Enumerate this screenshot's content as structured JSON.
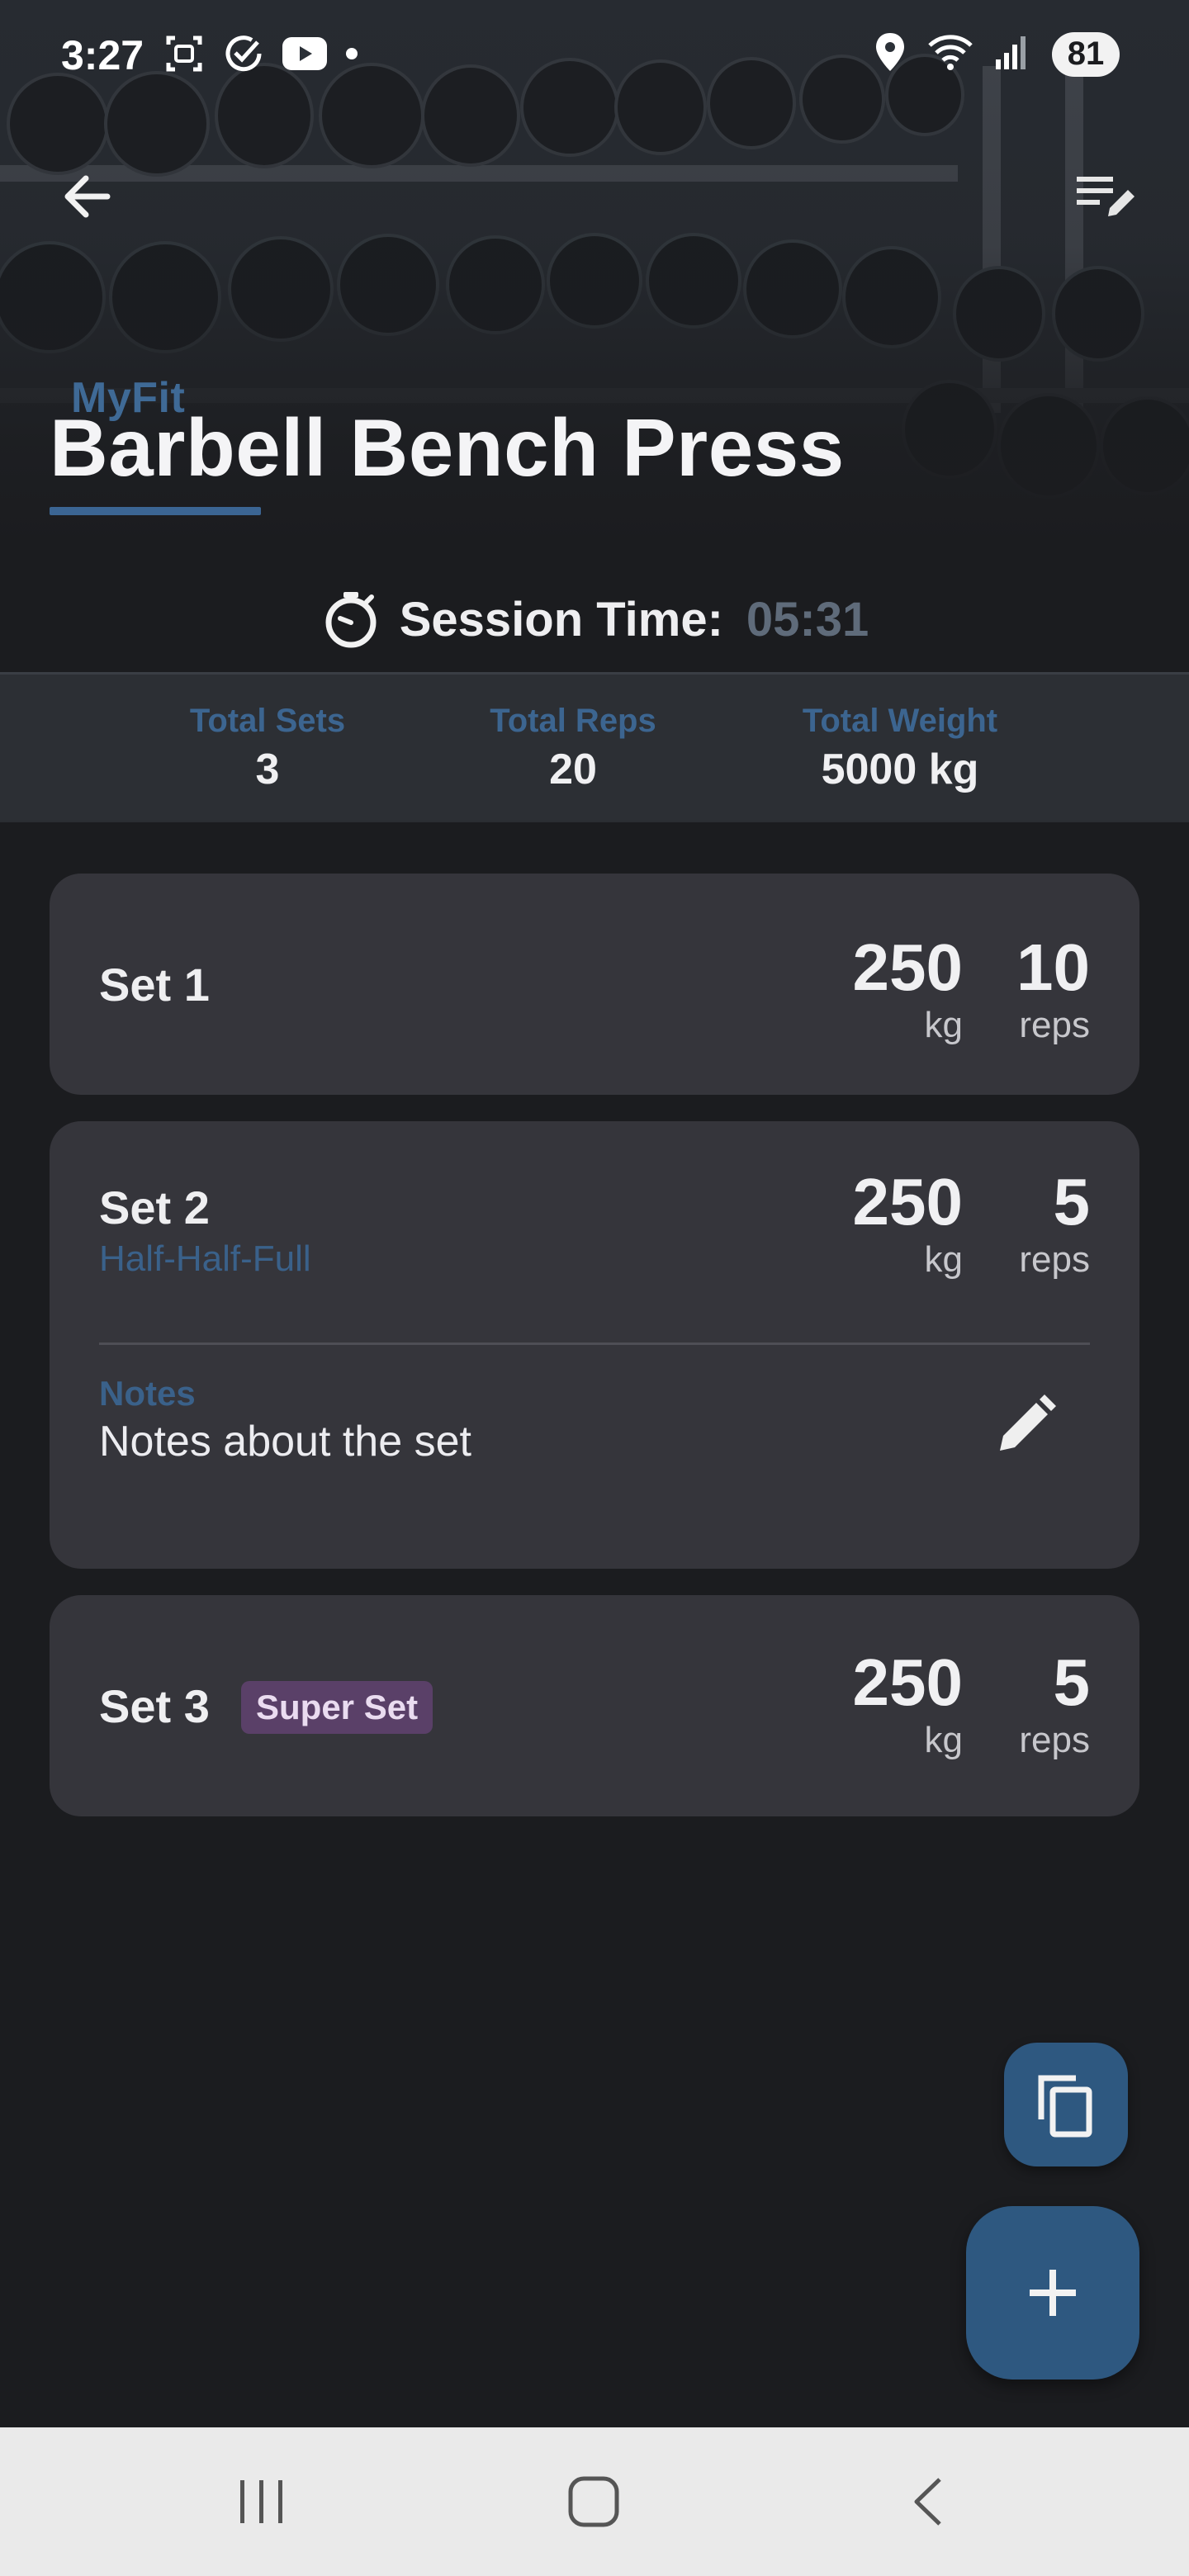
{
  "status_bar": {
    "time": "3:27",
    "battery": "81",
    "left_icons": [
      "screenshot-icon",
      "check-circle-icon",
      "youtube-icon",
      "dot-icon"
    ],
    "right_icons": [
      "location-icon",
      "wifi-icon",
      "signal-icon"
    ]
  },
  "header": {
    "brand": "MyFit",
    "title": "Barbell Bench Press",
    "back_icon": "arrow-left-icon",
    "edit_icon": "edit-list-icon"
  },
  "session": {
    "label": "Session Time:",
    "value": "05:31",
    "icon": "stopwatch-icon"
  },
  "stats": [
    {
      "label": "Total Sets",
      "value": "3"
    },
    {
      "label": "Total Reps",
      "value": "20"
    },
    {
      "label": "Total Weight",
      "value": "5000 kg"
    }
  ],
  "sets": [
    {
      "title": "Set 1",
      "weight": "250",
      "weight_unit": "kg",
      "reps": "10",
      "reps_unit": "reps"
    },
    {
      "title": "Set 2",
      "subtitle": "Half-Half-Full",
      "weight": "250",
      "weight_unit": "kg",
      "reps": "5",
      "reps_unit": "reps",
      "notes_label": "Notes",
      "notes_text": "Notes about the set"
    },
    {
      "title": "Set 3",
      "badge": "Super Set",
      "weight": "250",
      "weight_unit": "kg",
      "reps": "5",
      "reps_unit": "reps"
    }
  ],
  "fabs": {
    "copy_icon": "copy-icon",
    "add_icon": "plus-icon"
  },
  "nav": {
    "icons": [
      "recent-apps-icon",
      "home-icon",
      "back-icon"
    ]
  },
  "colors": {
    "background": "#1b1c1f",
    "card": "#35353b",
    "accent": "#2e5880",
    "accent_text": "#3c6590",
    "badge": "#5a4068"
  }
}
